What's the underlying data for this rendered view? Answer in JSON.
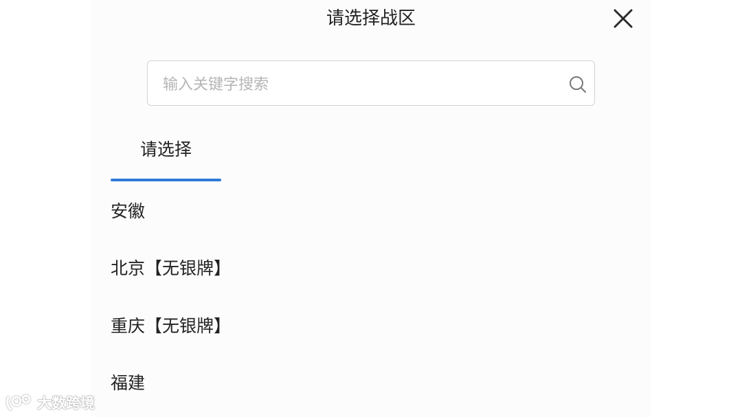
{
  "dialog": {
    "title": "请选择战区",
    "close_icon": "close-icon"
  },
  "search": {
    "placeholder": "输入关键字搜索",
    "value": "",
    "icon": "search-icon"
  },
  "tabs": [
    {
      "label": "请选择",
      "active": true
    }
  ],
  "colors": {
    "accent": "#2f7ad6",
    "panel_background": "#fcfcfc",
    "text": "#222222",
    "placeholder": "#b5b5b5"
  },
  "regions": [
    {
      "label": "安徽"
    },
    {
      "label": "北京【无银牌】"
    },
    {
      "label": "重庆【无银牌】"
    },
    {
      "label": "福建"
    }
  ],
  "watermark": {
    "text": "大数跨境",
    "icon": "logo-icon"
  }
}
